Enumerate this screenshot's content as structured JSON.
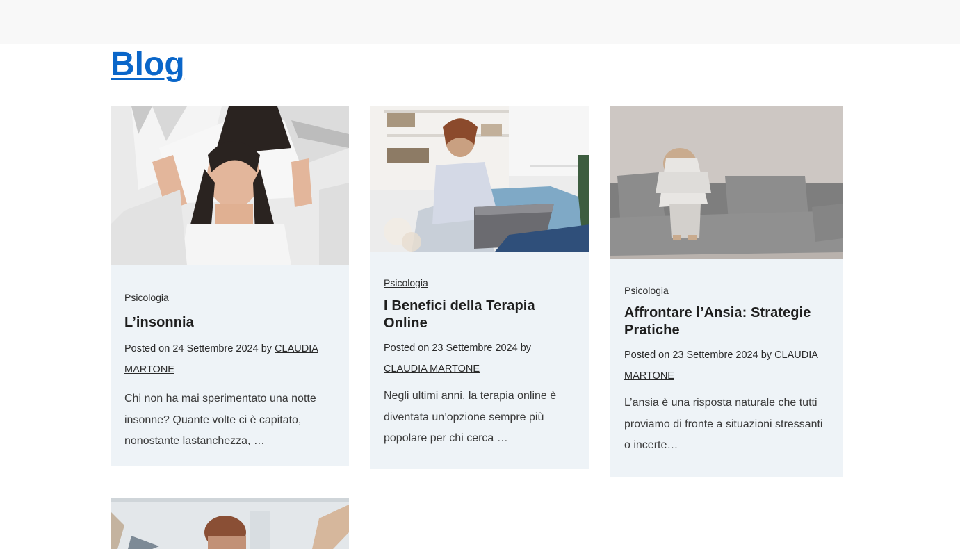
{
  "page": {
    "title": "Blog"
  },
  "posts": [
    {
      "category": "Psicologia",
      "title": "L’insonnia",
      "posted_prefix": "Posted on",
      "date": "24 Settembre 2024",
      "by": "by",
      "author": "CLAUDIA MARTONE",
      "excerpt": "Chi non ha mai sperimentato una notte insonne? Quante volte ci è capitato, nonostante lastanchezza, …",
      "image_alt": "woman-covering-ears-with-pillow"
    },
    {
      "category": "Psicologia",
      "title": "I Benefici della Terapia Online",
      "posted_prefix": "Posted on",
      "date": "23 Settembre 2024",
      "by": "by",
      "author": "CLAUDIA MARTONE",
      "excerpt": "Negli ultimi anni, la terapia online è diventata un’opzione sempre più popolare per chi cerca …",
      "image_alt": "woman-with-headphones-and-laptop"
    },
    {
      "category": "Psicologia",
      "title": "Affrontare l’Ansia: Strategie Pratiche",
      "posted_prefix": "Posted on",
      "date": "23 Settembre 2024",
      "by": "by",
      "author": "CLAUDIA MARTONE",
      "excerpt": "L’ansia è una risposta naturale che tutti proviamo di fronte a situazioni stressanti o incerte…",
      "image_alt": "woman-hugging-knees-on-sofa"
    },
    {
      "image_alt": "stressed-man-with-hands-on-head"
    }
  ]
}
